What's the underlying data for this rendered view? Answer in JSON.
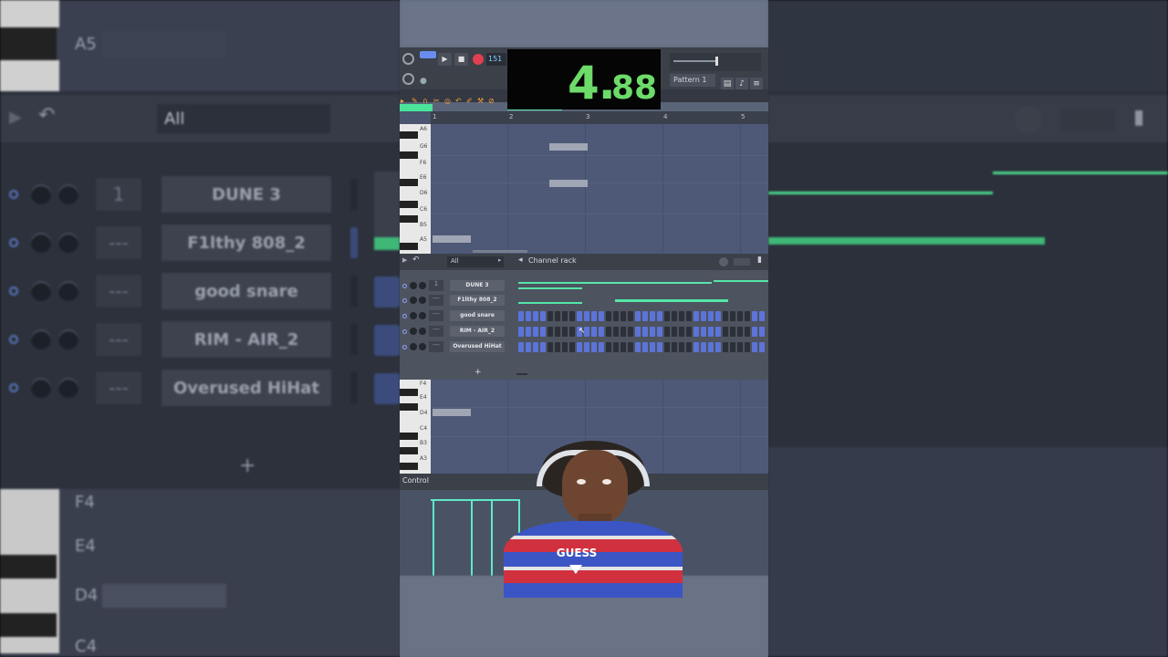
{
  "timer": {
    "whole": "4.",
    "fraction": "88"
  },
  "background_left": {
    "ruler_labels": [
      "A5",
      "F4",
      "E4",
      "D4",
      "C4"
    ],
    "filter": "All",
    "channels": [
      {
        "num": "1",
        "name": "DUNE 3"
      },
      {
        "num": "---",
        "name": "F1lthy 808_2"
      },
      {
        "num": "---",
        "name": "good snare"
      },
      {
        "num": "---",
        "name": "RIM - AIR_2"
      },
      {
        "num": "---",
        "name": "Overused HiHat"
      }
    ],
    "add": "+"
  },
  "toolbar": {
    "tempo": "151",
    "pattern": "Pattern 1"
  },
  "piano_roll_top": {
    "ruler": [
      "1",
      "2",
      "3",
      "4",
      "5"
    ],
    "keys": [
      "A6",
      "G6",
      "F6",
      "E6",
      "D6",
      "C6",
      "B5",
      "A5"
    ]
  },
  "channel_rack": {
    "title": "Channel rack",
    "filter": "All",
    "rows": [
      {
        "num": "1",
        "name": "DUNE 3"
      },
      {
        "num": "---",
        "name": "F1lthy 808_2"
      },
      {
        "num": "---",
        "name": "good snare"
      },
      {
        "num": "---",
        "name": "RIM - AIR_2"
      },
      {
        "num": "---",
        "name": "Overused HiHat"
      }
    ],
    "add": "+"
  },
  "piano_roll_bottom": {
    "keys": [
      "F4",
      "E4",
      "D4",
      "C4",
      "B3",
      "A3"
    ]
  },
  "control": {
    "label": "Control"
  },
  "person_shirt_text": "GUESS",
  "colors": {
    "accent_green": "#4be39a",
    "step_blue": "#5c74d8",
    "step_dark": "#2c3038",
    "timer_text": "#6ddb6a"
  }
}
